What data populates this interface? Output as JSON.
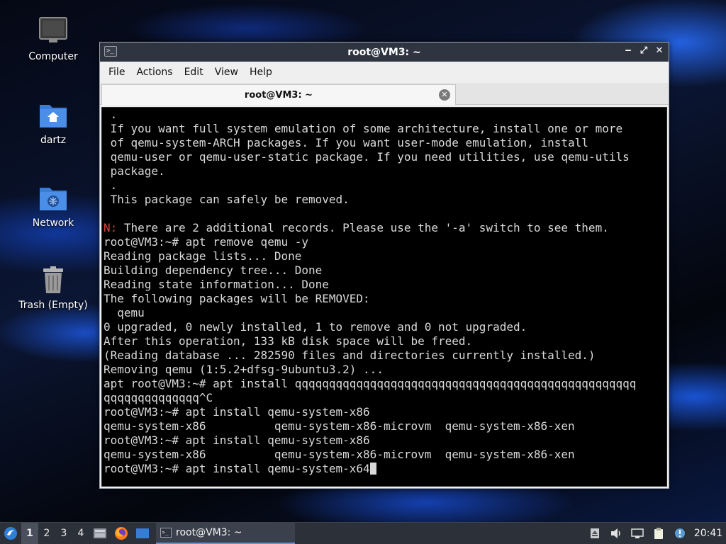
{
  "desktop": {
    "icons": [
      {
        "label": "Computer"
      },
      {
        "label": "dartz"
      },
      {
        "label": "Network"
      },
      {
        "label": "Trash (Empty)"
      }
    ]
  },
  "window": {
    "title": "root@VM3: ~",
    "controls": {
      "minimize": "‒",
      "maximize": "⤢",
      "close": "✕"
    },
    "menu": [
      "File",
      "Actions",
      "Edit",
      "View",
      "Help"
    ],
    "tab": {
      "label": "root@VM3: ~",
      "close": "✕"
    }
  },
  "terminal": {
    "lines": [
      " .",
      " If you want full system emulation of some architecture, install one or more",
      " of qemu-system-ARCH packages. If you want user-mode emulation, install",
      " qemu-user or qemu-user-static package. If you need utilities, use qemu-utils",
      " package.",
      " .",
      " This package can safely be removed.",
      "",
      "",
      "root@VM3:~# apt remove qemu -y",
      "Reading package lists... Done",
      "Building dependency tree... Done",
      "Reading state information... Done",
      "The following packages will be REMOVED:",
      "  qemu",
      "0 upgraded, 0 newly installed, 1 to remove and 0 not upgraded.",
      "After this operation, 133 kB disk space will be freed.",
      "(Reading database ... 282590 files and directories currently installed.)",
      "Removing qemu (1:5.2+dfsg-9ubuntu3.2) ...",
      "apt root@VM3:~# apt install qqqqqqqqqqqqqqqqqqqqqqqqqqqqqqqqqqqqqqqqqqqqqqqqqq",
      "qqqqqqqqqqqqqq^C",
      "root@VM3:~# apt install qemu-system-x86",
      "qemu-system-x86          qemu-system-x86-microvm  qemu-system-x86-xen",
      "root@VM3:~# apt install qemu-system-x86",
      "qemu-system-x86          qemu-system-x86-microvm  qemu-system-x86-xen"
    ],
    "notice_prefix": "N:",
    "notice_text": " There are 2 additional records. Please use the '-a' switch to see them.",
    "current_command": "root@VM3:~# apt install qemu-system-x64"
  },
  "taskbar": {
    "workspaces": [
      "1",
      "2",
      "3",
      "4"
    ],
    "active_workspace": "1",
    "task_label": "root@VM3: ~",
    "clock": "20:41"
  },
  "colors": {
    "terminal_bg": "#000000",
    "terminal_fg": "#d9d9d9",
    "notice_red": "#d8453b",
    "titlebar": "#2f3540",
    "taskbar": "#2c3038"
  }
}
